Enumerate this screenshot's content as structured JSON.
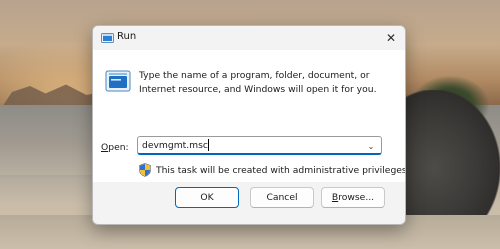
{
  "window": {
    "title": "Run",
    "close_icon": "close-icon"
  },
  "content": {
    "icon": "run-icon",
    "description": "Type the name of a program, folder, document, or Internet resource, and Windows will open it for you.",
    "open_label_prefix": "O",
    "open_label_rest": "pen:",
    "open_value": "devmgmt.msc",
    "admin_icon": "uac-shield-icon",
    "admin_note": "This task will be created with administrative privileges."
  },
  "buttons": {
    "ok": "OK",
    "cancel": "Cancel",
    "browse_prefix": "B",
    "browse_rest": "rowse..."
  },
  "colors": {
    "accent": "#0067c0",
    "dialog_bg": "#f3f3f3",
    "content_bg": "#ffffff"
  }
}
